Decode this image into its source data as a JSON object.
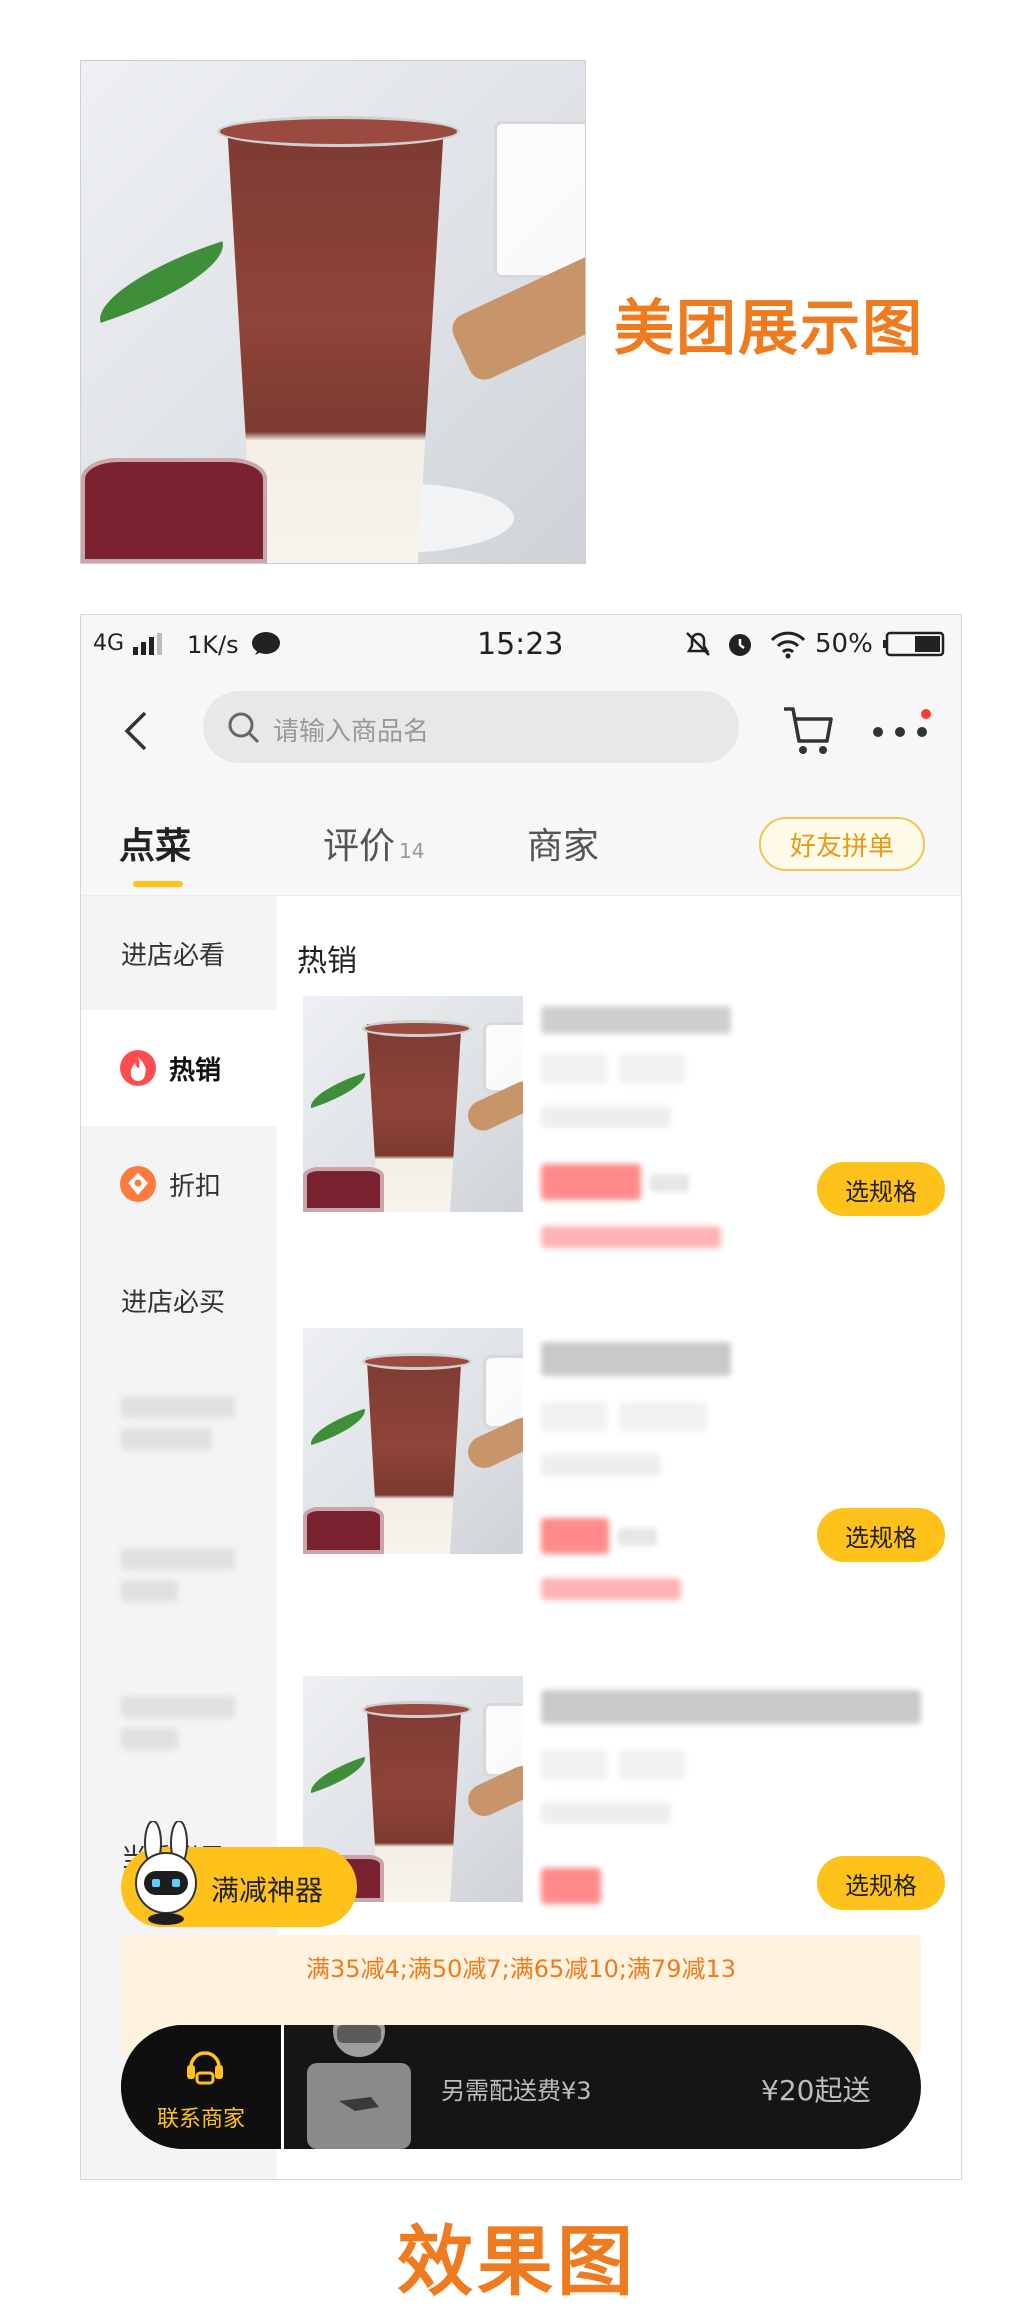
{
  "caption_top": "美团展示图",
  "caption_bottom": "效果图",
  "status": {
    "network": "4G",
    "speed": "1K/s",
    "time": "15:23",
    "battery": "50%"
  },
  "search": {
    "placeholder": "请输入商品名"
  },
  "tabs": [
    {
      "label": "点菜"
    },
    {
      "label": "评价",
      "count": "14"
    },
    {
      "label": "商家"
    }
  ],
  "group_order_label": "好友拼单",
  "sidebar": {
    "items": [
      {
        "label": "进店必看"
      },
      {
        "label": "热销"
      },
      {
        "label": "折扣"
      },
      {
        "label": "进店必买"
      },
      {
        "label": "当季鲜果"
      }
    ]
  },
  "section_title": "热销",
  "products": [
    {
      "name": "",
      "price": "",
      "button": "选规格"
    },
    {
      "name": "",
      "price": "",
      "button": "选规格"
    },
    {
      "name": "",
      "price": "",
      "button": "选规格"
    }
  ],
  "discount_badge": "满减神器",
  "promo_text": "满35减4;满50减7;满65减10;满79减13",
  "cart": {
    "contact_label": "联系商家",
    "delivery_fee": "另需配送费¥3",
    "min_order": "¥20起送"
  },
  "colors": {
    "accent_orange": "#f07b1f",
    "button_yellow": "#ffc21a",
    "price_red": "#ff4a4a",
    "cart_bar": "#151515"
  },
  "icons": [
    "back-arrow-icon",
    "search-icon",
    "cart-icon",
    "more-icon",
    "fire-icon",
    "discount-icon",
    "headset-icon",
    "robot-rabbit-icon",
    "delivery-rider-icon",
    "signal-icon",
    "chat-bubble-icon",
    "mute-bell-icon",
    "alarm-icon",
    "wifi-icon",
    "battery-icon"
  ]
}
